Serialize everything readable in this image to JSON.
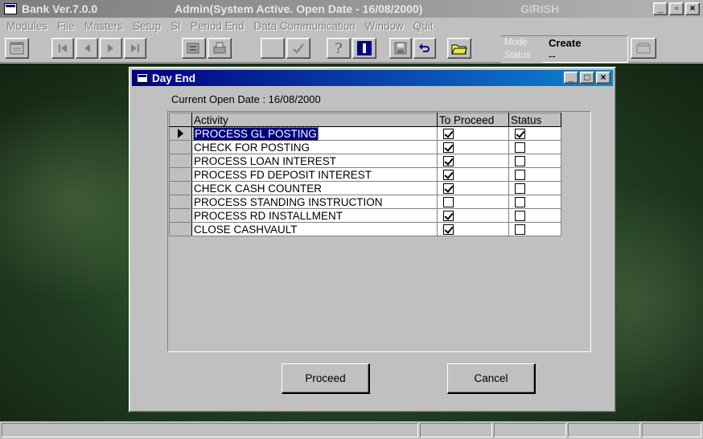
{
  "app": {
    "title": "Bank Ver.7.0.0",
    "session": "Admin(System Active. Open Date - 16/08/2000)",
    "user": "GIRISH",
    "window_buttons": [
      "_",
      "▫",
      "×"
    ]
  },
  "menu": [
    "Modules",
    "File",
    "Masters",
    "Setup",
    "SI",
    "Period End",
    "Data Communication",
    "Window",
    "Quit"
  ],
  "toolbar": {
    "icons": [
      "window-icon",
      "first-record-icon",
      "previous-record-icon",
      "next-record-icon",
      "last-record-icon",
      "find-icon",
      "print-icon",
      "blank-icon",
      "check-icon",
      "help-icon",
      "info-icon",
      "save-icon",
      "undo-icon",
      "open-folder-icon",
      "exit-icon"
    ],
    "mode_label": "Mode",
    "mode_value": "Create",
    "status_label": "Status",
    "status_value": "--"
  },
  "dialog": {
    "title": "Day End",
    "window_buttons": [
      "_",
      "□",
      "×"
    ],
    "open_date_text": "Current Open Date : 16/08/2000",
    "columns": [
      "Activity",
      "To Proceed",
      "Status"
    ],
    "rows": [
      {
        "activity": "PROCESS GL POSTING",
        "to_proceed": true,
        "status": true
      },
      {
        "activity": "CHECK FOR POSTING",
        "to_proceed": true,
        "status": false
      },
      {
        "activity": "PROCESS LOAN INTEREST",
        "to_proceed": true,
        "status": false
      },
      {
        "activity": "PROCESS FD DEPOSIT INTEREST",
        "to_proceed": true,
        "status": false
      },
      {
        "activity": "CHECK CASH COUNTER",
        "to_proceed": true,
        "status": false
      },
      {
        "activity": "PROCESS STANDING INSTRUCTION",
        "to_proceed": false,
        "status": false
      },
      {
        "activity": "PROCESS RD INSTALLMENT",
        "to_proceed": true,
        "status": false
      },
      {
        "activity": "CLOSE CASHVAULT",
        "to_proceed": true,
        "status": false
      }
    ],
    "proceed_label": "Proceed",
    "cancel_label": "Cancel"
  }
}
